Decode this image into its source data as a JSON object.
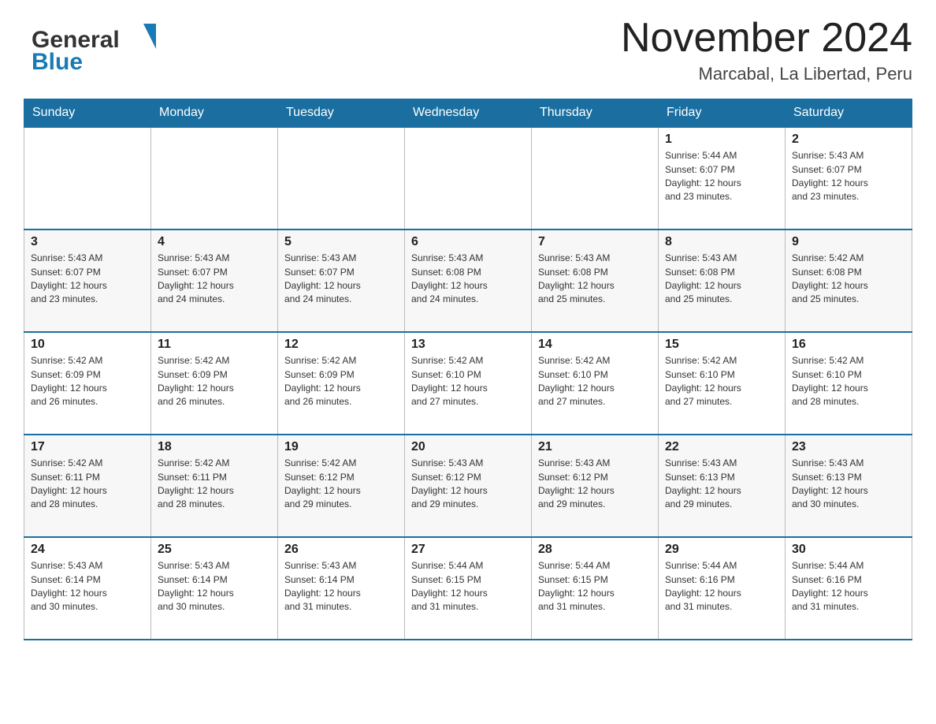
{
  "header": {
    "logo_general": "General",
    "logo_blue": "Blue",
    "title": "November 2024",
    "subtitle": "Marcabal, La Libertad, Peru"
  },
  "calendar": {
    "days_of_week": [
      "Sunday",
      "Monday",
      "Tuesday",
      "Wednesday",
      "Thursday",
      "Friday",
      "Saturday"
    ],
    "weeks": [
      [
        {
          "day": "",
          "info": ""
        },
        {
          "day": "",
          "info": ""
        },
        {
          "day": "",
          "info": ""
        },
        {
          "day": "",
          "info": ""
        },
        {
          "day": "",
          "info": ""
        },
        {
          "day": "1",
          "info": "Sunrise: 5:44 AM\nSunset: 6:07 PM\nDaylight: 12 hours\nand 23 minutes."
        },
        {
          "day": "2",
          "info": "Sunrise: 5:43 AM\nSunset: 6:07 PM\nDaylight: 12 hours\nand 23 minutes."
        }
      ],
      [
        {
          "day": "3",
          "info": "Sunrise: 5:43 AM\nSunset: 6:07 PM\nDaylight: 12 hours\nand 23 minutes."
        },
        {
          "day": "4",
          "info": "Sunrise: 5:43 AM\nSunset: 6:07 PM\nDaylight: 12 hours\nand 24 minutes."
        },
        {
          "day": "5",
          "info": "Sunrise: 5:43 AM\nSunset: 6:07 PM\nDaylight: 12 hours\nand 24 minutes."
        },
        {
          "day": "6",
          "info": "Sunrise: 5:43 AM\nSunset: 6:08 PM\nDaylight: 12 hours\nand 24 minutes."
        },
        {
          "day": "7",
          "info": "Sunrise: 5:43 AM\nSunset: 6:08 PM\nDaylight: 12 hours\nand 25 minutes."
        },
        {
          "day": "8",
          "info": "Sunrise: 5:43 AM\nSunset: 6:08 PM\nDaylight: 12 hours\nand 25 minutes."
        },
        {
          "day": "9",
          "info": "Sunrise: 5:42 AM\nSunset: 6:08 PM\nDaylight: 12 hours\nand 25 minutes."
        }
      ],
      [
        {
          "day": "10",
          "info": "Sunrise: 5:42 AM\nSunset: 6:09 PM\nDaylight: 12 hours\nand 26 minutes."
        },
        {
          "day": "11",
          "info": "Sunrise: 5:42 AM\nSunset: 6:09 PM\nDaylight: 12 hours\nand 26 minutes."
        },
        {
          "day": "12",
          "info": "Sunrise: 5:42 AM\nSunset: 6:09 PM\nDaylight: 12 hours\nand 26 minutes."
        },
        {
          "day": "13",
          "info": "Sunrise: 5:42 AM\nSunset: 6:10 PM\nDaylight: 12 hours\nand 27 minutes."
        },
        {
          "day": "14",
          "info": "Sunrise: 5:42 AM\nSunset: 6:10 PM\nDaylight: 12 hours\nand 27 minutes."
        },
        {
          "day": "15",
          "info": "Sunrise: 5:42 AM\nSunset: 6:10 PM\nDaylight: 12 hours\nand 27 minutes."
        },
        {
          "day": "16",
          "info": "Sunrise: 5:42 AM\nSunset: 6:10 PM\nDaylight: 12 hours\nand 28 minutes."
        }
      ],
      [
        {
          "day": "17",
          "info": "Sunrise: 5:42 AM\nSunset: 6:11 PM\nDaylight: 12 hours\nand 28 minutes."
        },
        {
          "day": "18",
          "info": "Sunrise: 5:42 AM\nSunset: 6:11 PM\nDaylight: 12 hours\nand 28 minutes."
        },
        {
          "day": "19",
          "info": "Sunrise: 5:42 AM\nSunset: 6:12 PM\nDaylight: 12 hours\nand 29 minutes."
        },
        {
          "day": "20",
          "info": "Sunrise: 5:43 AM\nSunset: 6:12 PM\nDaylight: 12 hours\nand 29 minutes."
        },
        {
          "day": "21",
          "info": "Sunrise: 5:43 AM\nSunset: 6:12 PM\nDaylight: 12 hours\nand 29 minutes."
        },
        {
          "day": "22",
          "info": "Sunrise: 5:43 AM\nSunset: 6:13 PM\nDaylight: 12 hours\nand 29 minutes."
        },
        {
          "day": "23",
          "info": "Sunrise: 5:43 AM\nSunset: 6:13 PM\nDaylight: 12 hours\nand 30 minutes."
        }
      ],
      [
        {
          "day": "24",
          "info": "Sunrise: 5:43 AM\nSunset: 6:14 PM\nDaylight: 12 hours\nand 30 minutes."
        },
        {
          "day": "25",
          "info": "Sunrise: 5:43 AM\nSunset: 6:14 PM\nDaylight: 12 hours\nand 30 minutes."
        },
        {
          "day": "26",
          "info": "Sunrise: 5:43 AM\nSunset: 6:14 PM\nDaylight: 12 hours\nand 31 minutes."
        },
        {
          "day": "27",
          "info": "Sunrise: 5:44 AM\nSunset: 6:15 PM\nDaylight: 12 hours\nand 31 minutes."
        },
        {
          "day": "28",
          "info": "Sunrise: 5:44 AM\nSunset: 6:15 PM\nDaylight: 12 hours\nand 31 minutes."
        },
        {
          "day": "29",
          "info": "Sunrise: 5:44 AM\nSunset: 6:16 PM\nDaylight: 12 hours\nand 31 minutes."
        },
        {
          "day": "30",
          "info": "Sunrise: 5:44 AM\nSunset: 6:16 PM\nDaylight: 12 hours\nand 31 minutes."
        }
      ]
    ]
  }
}
